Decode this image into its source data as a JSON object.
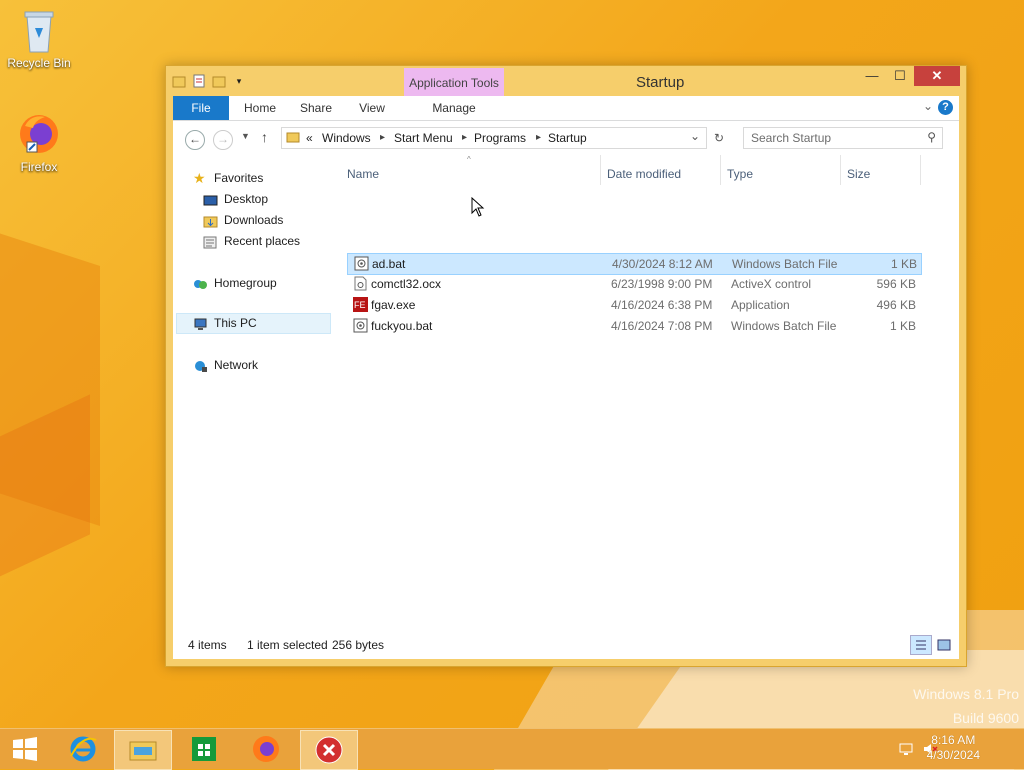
{
  "desktop": {
    "icons": [
      {
        "label": "Recycle Bin"
      },
      {
        "label": "Firefox"
      }
    ],
    "watermark": {
      "line1": "Windows 8.1 Pro",
      "line2": "Build 9600"
    }
  },
  "window": {
    "title": "Startup",
    "contextual_tab": "Application Tools",
    "ribbon_tabs": [
      "File",
      "Home",
      "Share",
      "View",
      "Manage"
    ],
    "address": {
      "overflow": "«",
      "parts": [
        "Windows",
        "Start Menu",
        "Programs",
        "Startup"
      ]
    },
    "search_placeholder": "Search Startup",
    "nav_pane": {
      "favorites": "Favorites",
      "desktop": "Desktop",
      "downloads": "Downloads",
      "recent": "Recent places",
      "homegroup": "Homegroup",
      "this_pc": "This PC",
      "network": "Network"
    },
    "columns": [
      "Name",
      "Date modified",
      "Type",
      "Size"
    ],
    "files": [
      {
        "name": "ad.bat",
        "date": "4/30/2024 8:12 AM",
        "type": "Windows Batch File",
        "size": "1 KB",
        "icon": "batch-file-icon",
        "selected": true
      },
      {
        "name": "comctl32.ocx",
        "date": "6/23/1998 9:00 PM",
        "type": "ActiveX control",
        "size": "596 KB",
        "icon": "activex-icon",
        "selected": false
      },
      {
        "name": "fgav.exe",
        "date": "4/16/2024 6:38 PM",
        "type": "Application",
        "size": "496 KB",
        "icon": "application-icon",
        "selected": false
      },
      {
        "name": "fuckyou.bat",
        "date": "4/16/2024 7:08 PM",
        "type": "Windows Batch File",
        "size": "1 KB",
        "icon": "batch-file-icon",
        "selected": false
      }
    ],
    "status": {
      "items": "4 items",
      "selected": "1 item selected",
      "bytes": "256 bytes"
    }
  },
  "taskbar": {
    "time": "8:16 AM",
    "date": "4/30/2024"
  }
}
